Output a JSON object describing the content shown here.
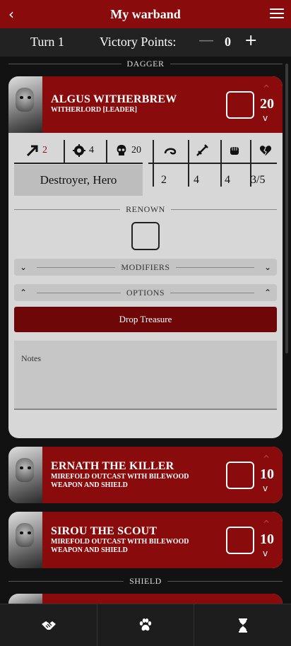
{
  "header": {
    "title": "My warband",
    "back_glyph": "‹"
  },
  "turn_bar": {
    "turn": "Turn 1",
    "vp_label": "Victory Points:",
    "vp_minus": "—",
    "vp_value": "0",
    "vp_plus": "+"
  },
  "groups": {
    "first": "DAGGER",
    "second": "SHIELD"
  },
  "fighters": [
    {
      "name": "ALGUS WITHERBREW",
      "subtitle": "WITHERLORD [LEADER]",
      "wounds": "20",
      "up_glyph": "^",
      "down_glyph": "v",
      "stats": {
        "move": "2",
        "toughness": "4",
        "wounds": "20"
      },
      "role": "Destroyer, Hero",
      "weapon": {
        "range": "2",
        "attacks": "4",
        "strength": "4",
        "damage": "3/5"
      },
      "renown_label": "RENOWN",
      "modifiers_label": "MODIFIERS",
      "options_label": "OPTIONS",
      "drop_treasure": "Drop Treasure",
      "notes_placeholder": "Notes"
    },
    {
      "name": "ERNATH THE KILLER",
      "subtitle": "MIREFOLD OUTCAST WITH BILEWOOD WEAPON AND SHIELD",
      "wounds": "10",
      "up_glyph": "^",
      "down_glyph": "v"
    },
    {
      "name": "SIROU THE SCOUT",
      "subtitle": "MIREFOLD OUTCAST WITH BILEWOOD WEAPON AND SHIELD",
      "wounds": "10",
      "up_glyph": "^",
      "down_glyph": "v"
    }
  ],
  "colors": {
    "primary": "#8a0b0b",
    "primary_dark": "#6e0808",
    "card_bg": "#d7d7d7",
    "app_bg": "#121212"
  },
  "bottom_nav": [
    {
      "icon": "handshake-icon"
    },
    {
      "icon": "paw-icon"
    },
    {
      "icon": "hourglass-icon"
    }
  ]
}
